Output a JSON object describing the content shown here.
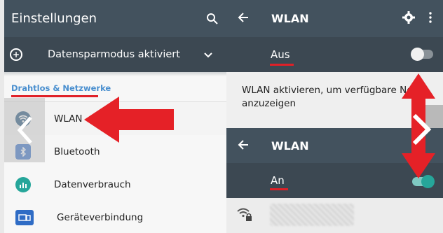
{
  "left": {
    "title": "Einstellungen",
    "data_saver": "Datensparmodus aktiviert",
    "section_label": "Drahtlos & Netzwerke",
    "items": [
      {
        "label": "WLAN",
        "icon": "wifi-icon",
        "color": "#1b4f78"
      },
      {
        "label": "Bluetooth",
        "icon": "bluetooth-icon",
        "color": "#2f6cc5"
      },
      {
        "label": "Datenverbrauch",
        "icon": "data-usage-icon",
        "color": "#26a69a"
      },
      {
        "label": "Geräteverbindung",
        "icon": "device-connection-icon",
        "color": "#2f6cc5"
      }
    ]
  },
  "right_top": {
    "title": "WLAN",
    "toggle_label": "Aus",
    "toggle_on": false,
    "message": "WLAN aktivieren, um verfügbare Netze anzuzeigen"
  },
  "right_bottom": {
    "title": "WLAN",
    "toggle_label": "An",
    "toggle_on": true
  },
  "colors": {
    "appbar": "#43525e",
    "accent_red": "#e02027",
    "switch_on": "#26a69a",
    "section_blue": "#4a8fcf"
  }
}
